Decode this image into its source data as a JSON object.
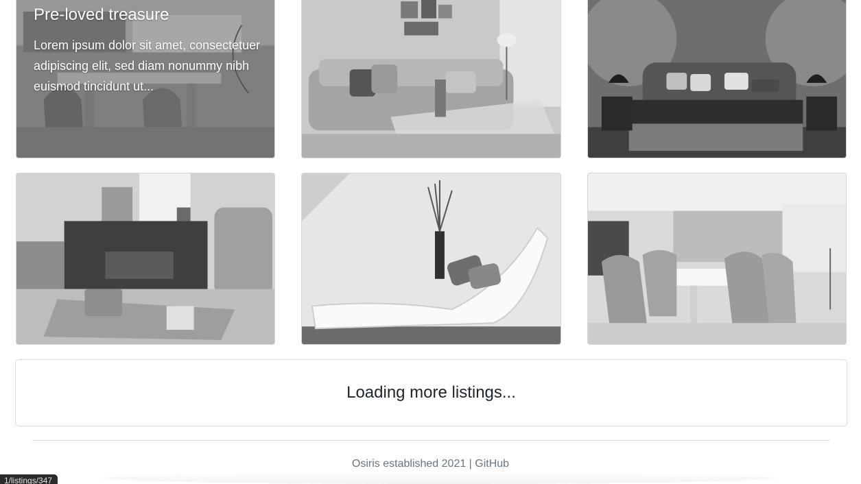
{
  "cards": [
    {
      "title": "Pre-loved treasure",
      "description": "Lorem ipsum dolor sit amet, consectetuer adipiscing elit, sed diam nonummy nibh euismod tincidunt ut..."
    }
  ],
  "images": [
    {
      "name": "dining-room-photo"
    },
    {
      "name": "living-room-sofa-photo"
    },
    {
      "name": "bedroom-photo"
    },
    {
      "name": "sideboard-room-photo"
    },
    {
      "name": "chaise-lounge-photo"
    },
    {
      "name": "dining-table-photo"
    }
  ],
  "loading": {
    "text": "Loading more listings..."
  },
  "footer": {
    "prefix": "Osiris established 2021 | ",
    "link_label": "GitHub"
  },
  "status_bar": {
    "url": "1/listings/347"
  },
  "colors": {
    "footer_text": "#6c757d",
    "border": "#dcdcdc",
    "status_bg": "#2b2b2b"
  }
}
